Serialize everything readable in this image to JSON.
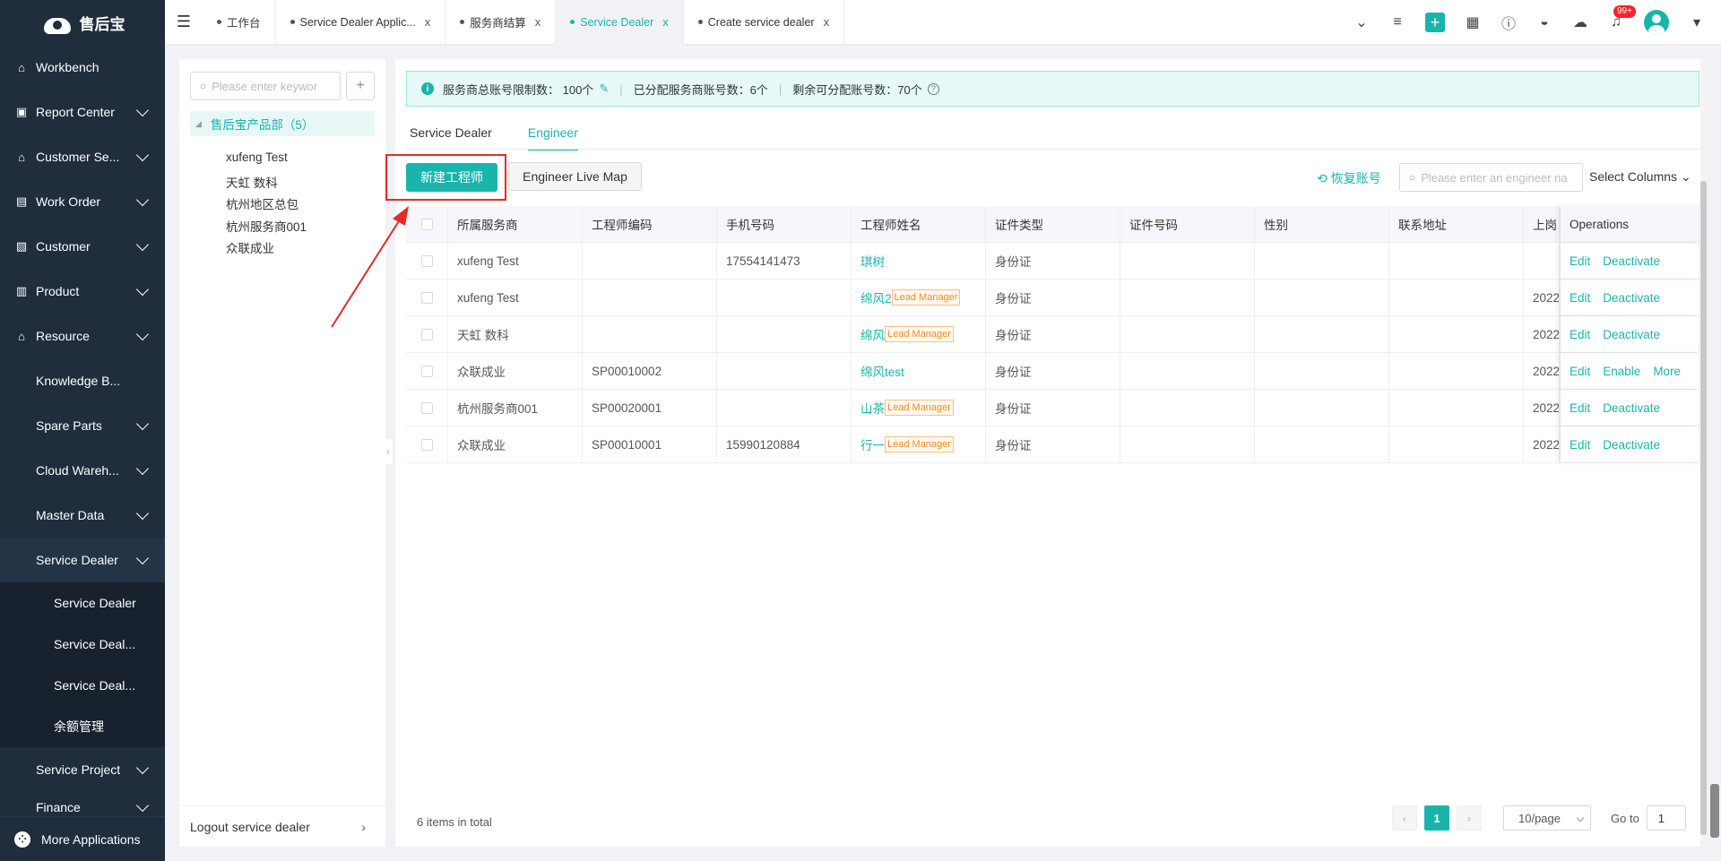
{
  "app": {
    "logo_text": "售后宝"
  },
  "sidebar": {
    "items": [
      {
        "label": "Workbench",
        "icon": "home-icon"
      },
      {
        "label": "Report Center",
        "icon": "report-icon"
      },
      {
        "label": "Customer Se...",
        "icon": "service-icon"
      },
      {
        "label": "Work Order",
        "icon": "work-order-icon"
      },
      {
        "label": "Customer",
        "icon": "customer-icon"
      },
      {
        "label": "Product",
        "icon": "product-icon"
      },
      {
        "label": "Resource",
        "icon": "resource-icon"
      }
    ],
    "resource_sub": [
      {
        "label": "Knowledge B..."
      },
      {
        "label": "Spare Parts"
      },
      {
        "label": "Cloud Wareh..."
      },
      {
        "label": "Master Data"
      },
      {
        "label": "Service Dealer"
      }
    ],
    "service_dealer_sub": [
      {
        "label": "Service Dealer"
      },
      {
        "label": "Service Deal..."
      },
      {
        "label": "Service Deal..."
      },
      {
        "label": "余额管理"
      }
    ],
    "service_project": "Service Project",
    "finance": "Finance",
    "more_apps": "More Applications"
  },
  "topbar": {
    "tabs": [
      {
        "label": "工作台",
        "closable": false
      },
      {
        "label": "Service Dealer Applic...",
        "closable": true
      },
      {
        "label": "服务商结算",
        "closable": true
      },
      {
        "label": "Service Dealer",
        "closable": true,
        "active": true
      },
      {
        "label": "Create service dealer",
        "closable": true
      }
    ],
    "close_glyph": "x",
    "notification_badge": "99+"
  },
  "tree": {
    "search_placeholder": "Please enter keywor",
    "root": "售后宝产品部（5）",
    "children": [
      "xufeng Test",
      "天虹 数科",
      "杭州地区总包",
      "杭州服务商001",
      "众联成业"
    ],
    "footer": "Logout service dealer"
  },
  "notice": {
    "total_limit": "服务商总账号限制数： 100个",
    "allocated": "已分配服务商账号数：6个",
    "remaining": "剩余可分配账号数：70个"
  },
  "subtabs": [
    "Service Dealer",
    "Engineer"
  ],
  "toolbar": {
    "new_engineer": "新建工程师",
    "live_map": "Engineer Live Map",
    "restore": "恢复账号",
    "search_placeholder": "Please enter an engineer na",
    "select_columns": "Select Columns"
  },
  "table": {
    "headers": [
      "所属服务商",
      "工程师编码",
      "手机号码",
      "工程师姓名",
      "证件类型",
      "证件号码",
      "性别",
      "联系地址",
      "上岗",
      "Operations"
    ],
    "rows": [
      {
        "dealer": "xufeng Test",
        "code": "",
        "phone": "17554141473",
        "name": "琪树",
        "lead": "",
        "id_type": "身份证",
        "id_no": "",
        "gender": "",
        "address": "",
        "date": "",
        "ops": [
          "Edit",
          "Deactivate"
        ]
      },
      {
        "dealer": "xufeng Test",
        "code": "",
        "phone": "",
        "name": "绵风2",
        "lead": "Lead Manager",
        "id_type": "身份证",
        "id_no": "",
        "gender": "",
        "address": "",
        "date": "2022",
        "ops": [
          "Edit",
          "Deactivate"
        ]
      },
      {
        "dealer": "天虹 数科",
        "code": "",
        "phone": "",
        "name": "绵风",
        "lead": "Lead Manager",
        "id_type": "身份证",
        "id_no": "",
        "gender": "",
        "address": "",
        "date": "2022",
        "ops": [
          "Edit",
          "Deactivate"
        ]
      },
      {
        "dealer": "众联成业",
        "code": "SP00010002",
        "phone": "",
        "name": "绵风test",
        "lead": "",
        "id_type": "身份证",
        "id_no": "",
        "gender": "",
        "address": "",
        "date": "2022",
        "ops": [
          "Edit",
          "Enable",
          "More"
        ]
      },
      {
        "dealer": "杭州服务商001",
        "code": "SP00020001",
        "phone": "",
        "name": "山茶",
        "lead": "Lead Manager",
        "id_type": "身份证",
        "id_no": "",
        "gender": "",
        "address": "",
        "date": "2022",
        "ops": [
          "Edit",
          "Deactivate"
        ]
      },
      {
        "dealer": "众联成业",
        "code": "SP00010001",
        "phone": "15990120884",
        "name": "行一",
        "lead": "Lead Manager",
        "id_type": "身份证",
        "id_no": "",
        "gender": "",
        "address": "",
        "date": "2022",
        "ops": [
          "Edit",
          "Deactivate"
        ]
      }
    ]
  },
  "pagination": {
    "total": "6 items in total",
    "current_page": "1",
    "page_size": "10/page",
    "goto_label": "Go to",
    "goto_value": "1"
  },
  "colors": {
    "accent": "#19b5ad",
    "sidebar_bg": "#1f2d3d",
    "highlight_red": "#e62a2a",
    "lead_tag": "#fa8c16"
  }
}
